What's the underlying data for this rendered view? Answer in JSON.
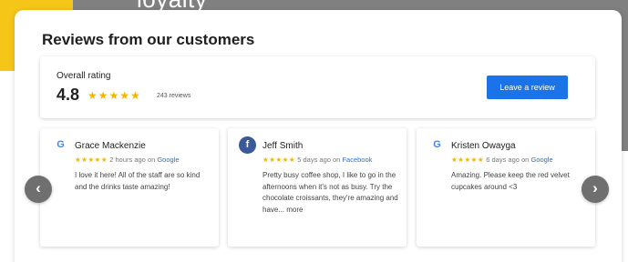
{
  "background": {
    "heading": "loyalty",
    "colors": {
      "yellow": "#f5c518",
      "gray": "#808080"
    }
  },
  "widget": {
    "title": "Reviews from our customers",
    "overall": {
      "label": "Overall rating",
      "score": "4.8",
      "stars": "★★★★★",
      "review_count": "243 reviews",
      "leave_button": "Leave a review"
    },
    "reviews": [
      {
        "name": "Grace Mackenzie",
        "source_icon": "google-icon",
        "source_glyph": "G",
        "stars": "★★★★★",
        "time": "2 hours ago on ",
        "source": "Google",
        "text": "I love it here! All of the staff are so kind and the drinks taste amazing!"
      },
      {
        "name": "Jeff Smith",
        "source_icon": "facebook-icon",
        "source_glyph": "f",
        "stars": "★★★★★",
        "time": "5 days ago on ",
        "source": "Facebook",
        "text": "Pretty busy coffee shop, I like to go in the afternoons when it's not as busy. Try the chocolate croissants, they're amazing and have...",
        "more": "more"
      },
      {
        "name": "Kristen Owayga",
        "source_icon": "google-icon",
        "source_glyph": "G",
        "stars": "★★★★★",
        "time": "6 days ago on ",
        "source": "Google",
        "text": "Amazing. Please keep the red velvet cupcakes around <3"
      }
    ],
    "nav": {
      "prev": "‹",
      "next": "›"
    },
    "accent": "#1a73e8",
    "star_color": "#f4b400"
  }
}
